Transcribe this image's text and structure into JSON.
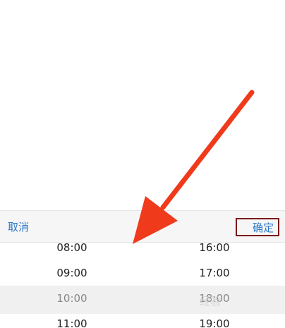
{
  "toolbar": {
    "cancel_label": "取消",
    "confirm_label": "确定"
  },
  "picker": {
    "start_column": [
      "08:00",
      "09:00",
      "10:00",
      "11:00"
    ],
    "end_column": [
      "16:00",
      "17:00",
      "18:00",
      "19:00"
    ],
    "selected_row_index": 2
  },
  "watermark": {
    "text": "经验"
  },
  "annotation": {
    "arrow_color": "#f03a1c",
    "highlight_box_color": "#7a1a1a"
  }
}
